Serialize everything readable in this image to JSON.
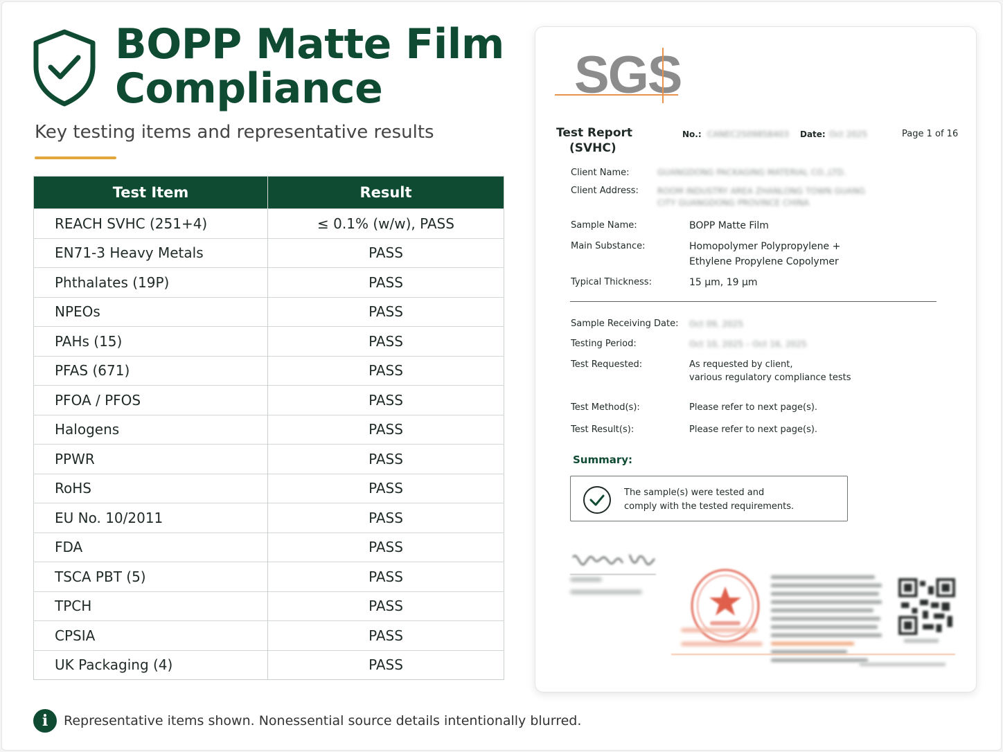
{
  "header": {
    "title_line1": "BOPP Matte Film",
    "title_line2": "Compliance",
    "subtitle": "Key testing items and representative results"
  },
  "colors": {
    "brand_green": "#0f4a33",
    "accent_gold": "#e3a63a",
    "sgs_gray": "#8c8c8c",
    "sgs_orange": "#e8934c",
    "stamp_red": "#d9432c"
  },
  "icons": {
    "shield": "shield-check-icon",
    "info": "info-icon",
    "summary_check": "check-circle-icon"
  },
  "table": {
    "headers": [
      "Test Item",
      "Result"
    ],
    "rows": [
      {
        "item": "REACH SVHC (251+4)",
        "result": "≤ 0.1% (w/w), PASS"
      },
      {
        "item": "EN71-3 Heavy Metals",
        "result": "PASS"
      },
      {
        "item": "Phthalates (19P)",
        "result": "PASS"
      },
      {
        "item": "NPEOs",
        "result": "PASS"
      },
      {
        "item": "PAHs (15)",
        "result": "PASS"
      },
      {
        "item": "PFAS (671)",
        "result": "PASS"
      },
      {
        "item": "PFOA / PFOS",
        "result": "PASS"
      },
      {
        "item": "Halogens",
        "result": "PASS"
      },
      {
        "item": "PPWR",
        "result": "PASS"
      },
      {
        "item": "RoHS",
        "result": "PASS"
      },
      {
        "item": "EU No. 10/2011",
        "result": "PASS"
      },
      {
        "item": "FDA",
        "result": "PASS"
      },
      {
        "item": "TSCA PBT (5)",
        "result": "PASS"
      },
      {
        "item": "TPCH",
        "result": "PASS"
      },
      {
        "item": "CPSIA",
        "result": "PASS"
      },
      {
        "item": "UK Packaging (4)",
        "result": "PASS"
      }
    ]
  },
  "footnote": "Representative items shown. Nonessential source details intentionally blurred.",
  "report": {
    "logo_text": "SGS",
    "title_line1": "Test Report",
    "title_line2": "(SVHC)",
    "no_label": "No.:",
    "date_label": "Date:",
    "page": "Page 1 of 16",
    "client_name_label": "Client Name:",
    "client_address_label": "Client Address:",
    "sample_name_label": "Sample Name:",
    "sample_name": "BOPP Matte Film",
    "main_substance_label": "Main Substance:",
    "main_substance_line1": "Homopolymer Polypropylene +",
    "main_substance_line2": "Ethylene Propylene Copolymer",
    "thickness_label": "Typical Thickness:",
    "thickness": "15 µm, 19 µm",
    "receiving_date_label": "Sample Receiving Date:",
    "testing_period_label": "Testing Period:",
    "test_requested_label": "Test Requested:",
    "test_requested_line1": "As requested by client,",
    "test_requested_line2": "various regulatory compliance tests",
    "test_methods_label": "Test Method(s):",
    "test_methods": "Please refer to next page(s).",
    "test_results_label": "Test Result(s):",
    "test_results": "Please refer to next page(s).",
    "summary_label": "Summary:",
    "summary_line1": "The sample(s) were tested and",
    "summary_line2": "comply with the tested requirements."
  }
}
